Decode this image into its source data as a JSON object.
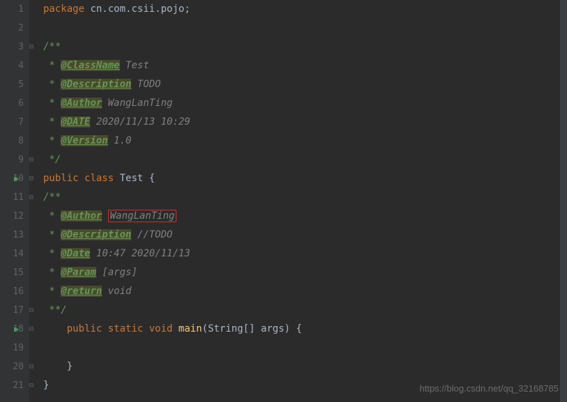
{
  "lines": [
    {
      "num": "1",
      "type": "package"
    },
    {
      "num": "2",
      "type": "blank"
    },
    {
      "num": "3",
      "type": "doc-open"
    },
    {
      "num": "4",
      "type": "doc-tag",
      "tag": "@ClassName",
      "value": "Test"
    },
    {
      "num": "5",
      "type": "doc-tag",
      "tag": "@Description",
      "value": "TODO"
    },
    {
      "num": "6",
      "type": "doc-tag",
      "tag": "@Author",
      "value": "WangLanTing"
    },
    {
      "num": "7",
      "type": "doc-tag",
      "tag": "@DATE",
      "value": "2020/11/13 10:29"
    },
    {
      "num": "8",
      "type": "doc-tag",
      "tag": "@Version",
      "value": "1.0"
    },
    {
      "num": "9",
      "type": "doc-close"
    },
    {
      "num": "10",
      "type": "class-decl"
    },
    {
      "num": "11",
      "type": "doc-open2"
    },
    {
      "num": "12",
      "type": "doc-author-red"
    },
    {
      "num": "13",
      "type": "doc-desc-todo"
    },
    {
      "num": "14",
      "type": "doc-tag2",
      "tag": "@Date",
      "value": "10:47 2020/11/13"
    },
    {
      "num": "15",
      "type": "doc-tag2",
      "tag": "@Param",
      "value": "[args]"
    },
    {
      "num": "16",
      "type": "doc-tag2",
      "tag": "@return",
      "value": "void"
    },
    {
      "num": "17",
      "type": "doc-close2"
    },
    {
      "num": "18",
      "type": "method-decl"
    },
    {
      "num": "19",
      "type": "blank2"
    },
    {
      "num": "20",
      "type": "method-close"
    },
    {
      "num": "21",
      "type": "class-close"
    }
  ],
  "pkg": {
    "kw": "package",
    "name": "cn.com.csii.pojo",
    "semi": ";"
  },
  "doc_open": "/**",
  "doc_star": " * ",
  "doc_close": " */",
  "doc_close2": " **/",
  "tags": {
    "classname": "@ClassName",
    "description": "@Description",
    "author": "@Author",
    "date_upper": "@DATE",
    "version": "@Version",
    "date": "@Date",
    "param": "@Param",
    "return": "@return"
  },
  "values": {
    "test": "Test",
    "todo": "TODO",
    "author_name": "WangLanTing",
    "date1": "2020/11/13 10:29",
    "version": "1.0",
    "slash_todo": "//TODO",
    "date2": "10:47 2020/11/13",
    "args_bracket": "[args]",
    "void": "void"
  },
  "class_decl": {
    "public": "public",
    "class": "class",
    "name": "Test",
    "brace": "{"
  },
  "method": {
    "public": "public",
    "static": "static",
    "void": "void",
    "name": "main",
    "lparen": "(",
    "type": "String[]",
    "param": "args",
    "rparen": ")",
    "brace": "{"
  },
  "close_brace": "}",
  "watermark": "https://blog.csdn.net/qq_32168785"
}
